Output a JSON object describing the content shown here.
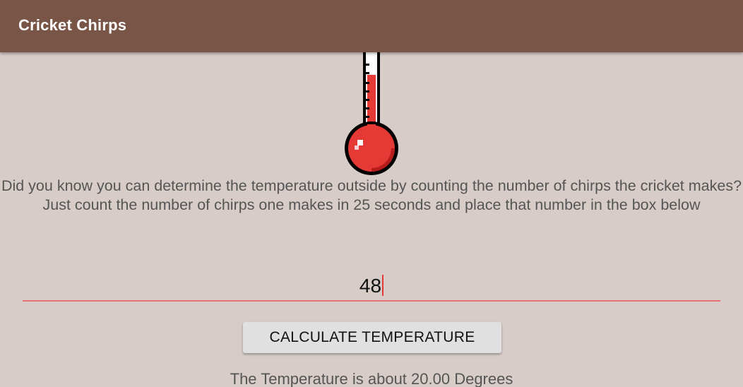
{
  "appbar": {
    "title": "Cricket Chirps",
    "color": "#795548"
  },
  "thermometer": {
    "icon": "thermometer-icon",
    "fill_color": "#e53935"
  },
  "main": {
    "description": "Did you know you can determine the temperature outside by counting the number of chirps the cricket makes? Just count the number of chirps one makes in 25 seconds and place that number in the box below",
    "chirps_input": {
      "value": "48",
      "accent_color": "#e57373"
    },
    "calculate_button_label": "CALCULATE TEMPERATURE",
    "result_text": "The Temperature is about 20.00 Degrees"
  },
  "colors": {
    "background": "#d7ccc8",
    "text": "#555555"
  }
}
